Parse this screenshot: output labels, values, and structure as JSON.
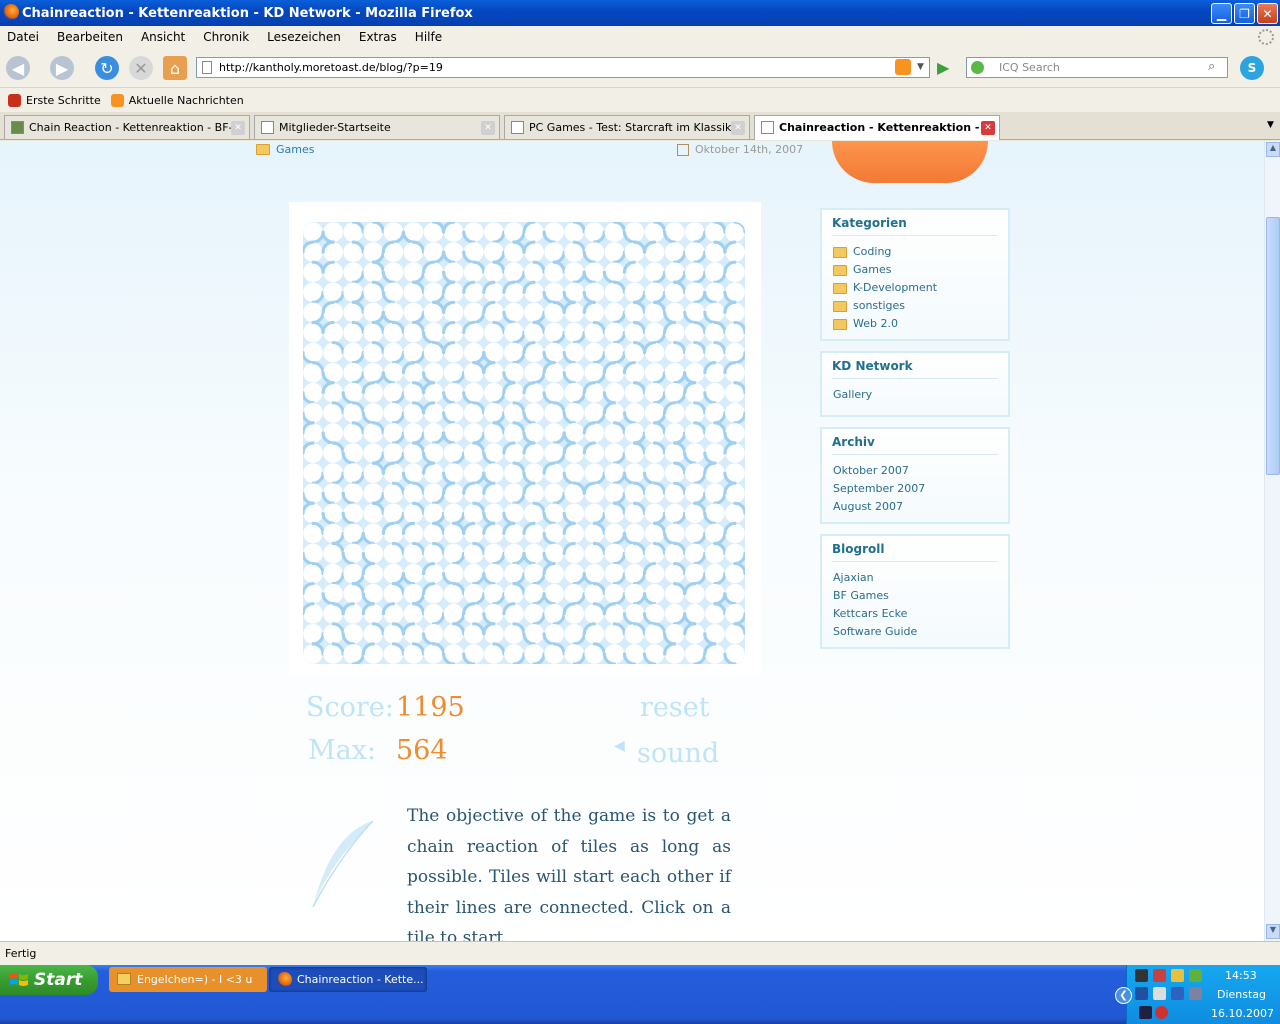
{
  "window": {
    "title": "Chainreaction - Kettenreaktion - KD Network - Mozilla Firefox"
  },
  "menu": [
    "Datei",
    "Bearbeiten",
    "Ansicht",
    "Chronik",
    "Lesezeichen",
    "Extras",
    "Hilfe"
  ],
  "nav": {
    "url": "http://kantholy.moretoast.de/blog/?p=19",
    "search_placeholder": "ICQ Search"
  },
  "bookmarks": [
    "Erste Schritte",
    "Aktuelle Nachrichten"
  ],
  "tabs": [
    {
      "label": "Chain Reaction - Kettenreaktion - BF-..."
    },
    {
      "label": "Mitglieder-Startseite"
    },
    {
      "label": "PC Games - Test: Starcraft im Klassik-..."
    },
    {
      "label": "Chainreaction - Kettenreaktion - ..."
    }
  ],
  "post": {
    "category": "Games",
    "date": "Oktober 14th, 2007"
  },
  "game": {
    "score_label": "Score:",
    "score_value": "1195",
    "max_label": "Max:",
    "max_value": "564",
    "reset_label": "reset",
    "sound_label": "sound",
    "description": "The objective of the game is to get a chain reaction of tiles as long as possible. Tiles will start each other if their lines are connected. Click on a tile to start.",
    "grid_size": 22
  },
  "sidebar": {
    "categories": {
      "title": "Kategorien",
      "items": [
        "Coding",
        "Games",
        "K-Development",
        "sonstiges",
        "Web 2.0"
      ]
    },
    "network": {
      "title": "KD Network",
      "items": [
        "Gallery"
      ]
    },
    "archive": {
      "title": "Archiv",
      "items": [
        "Oktober 2007",
        "September 2007",
        "August 2007"
      ]
    },
    "blogroll": {
      "title": "Blogroll",
      "items": [
        "Ajaxian",
        "BF Games",
        "Kettcars Ecke",
        "Software Guide"
      ]
    }
  },
  "status": "Fertig",
  "taskbar": {
    "start": "Start",
    "tasks": [
      "Engelchen=) - I <3 u",
      "Chainreaction - Kette..."
    ],
    "time": "14:53",
    "day": "Dienstag",
    "date": "16.10.2007"
  },
  "colors": {
    "accent": "#f08c2e",
    "tile_line": "#9fd0f2",
    "link": "#2b6d8c"
  }
}
